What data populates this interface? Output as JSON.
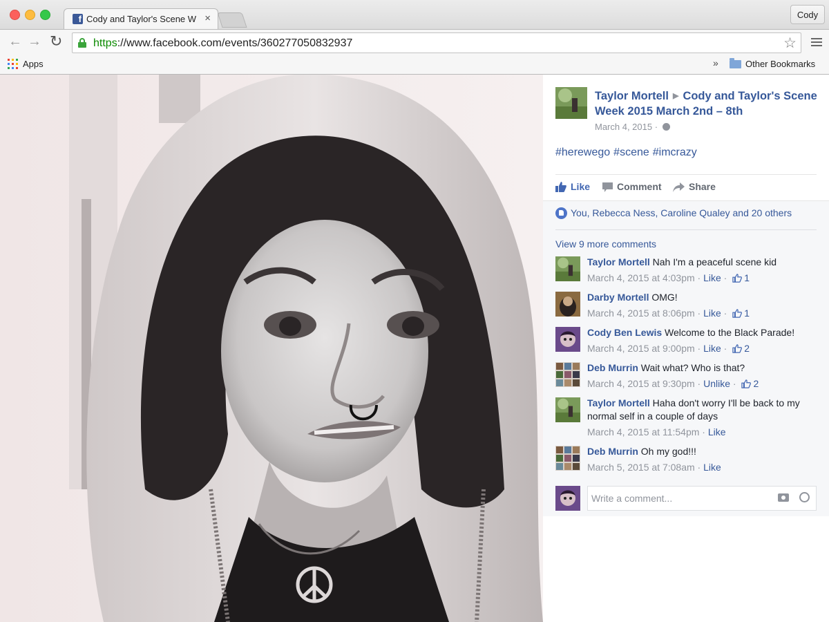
{
  "browser": {
    "tab_title": "Cody and Taylor's Scene W",
    "tab_close": "×",
    "profile": "Cody",
    "url_scheme": "https",
    "url_rest": "://www.facebook.com/events/360277050832937",
    "apps_label": "Apps",
    "bookmarks_chevron": "»",
    "other_bookmarks": "Other Bookmarks"
  },
  "post": {
    "author": "Taylor Mortell",
    "event": "Cody and Taylor's Scene Week 2015 March 2nd – 8th",
    "date": "March 4, 2015",
    "date_sep": " · ",
    "hashtags": [
      "#herewego",
      "#scene",
      "#imcrazy"
    ],
    "actions": {
      "like": "Like",
      "comment": "Comment",
      "share": "Share"
    },
    "likes_summary": "You, Rebecca Ness, Caroline Qualey and 20 others",
    "view_more": "View 9 more comments"
  },
  "comments": [
    {
      "author": "Taylor Mortell",
      "text": "Nah I'm a peaceful scene kid",
      "time": "March 4, 2015 at 4:03pm",
      "action": "Like",
      "likes": "1",
      "avatar": "taylor"
    },
    {
      "author": "Darby Mortell",
      "text": "OMG!",
      "time": "March 4, 2015 at 8:06pm",
      "action": "Like",
      "likes": "1",
      "avatar": "darby"
    },
    {
      "author": "Cody Ben Lewis",
      "text": "Welcome to the Black Parade!",
      "time": "March 4, 2015 at 9:00pm",
      "action": "Like",
      "likes": "2",
      "avatar": "cody"
    },
    {
      "author": "Deb Murrin",
      "text": "Wait what? Who is that?",
      "time": "March 4, 2015 at 9:30pm",
      "action": "Unlike",
      "likes": "2",
      "avatar": "deb"
    },
    {
      "author": "Taylor Mortell",
      "text": "Haha don't worry I'll be back to my normal self in a couple of days",
      "time": "March 4, 2015 at 11:54pm",
      "action": "Like",
      "likes": "",
      "avatar": "taylor"
    },
    {
      "author": "Deb Murrin",
      "text": "Oh my god!!!",
      "time": "March 5, 2015 at 7:08am",
      "action": "Like",
      "likes": "",
      "avatar": "deb"
    }
  ],
  "composer": {
    "placeholder": "Write a comment..."
  },
  "colors": {
    "facebook_blue": "#365899",
    "like_blue": "#4267b2",
    "meta_gray": "#90949c"
  }
}
